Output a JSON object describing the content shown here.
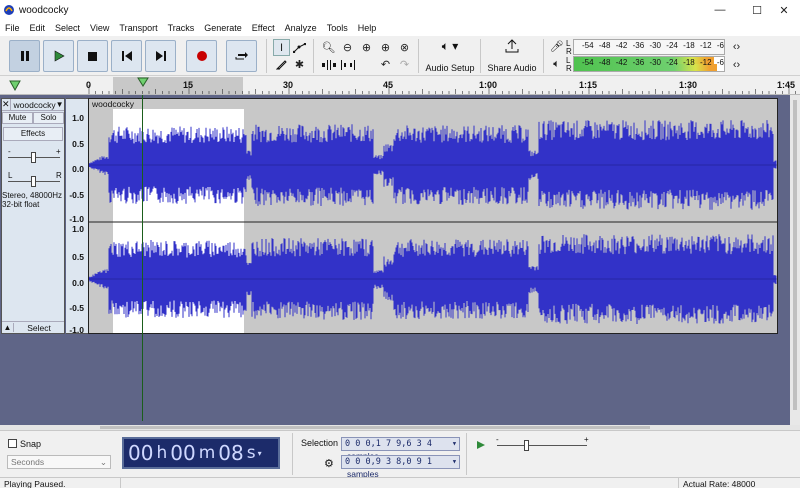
{
  "window": {
    "title": "woodcocky",
    "minimize_icon": "minimize-icon",
    "maximize_icon": "maximize-icon",
    "close_icon": "close-icon"
  },
  "menu": [
    "File",
    "Edit",
    "Select",
    "View",
    "Transport",
    "Tracks",
    "Generate",
    "Effect",
    "Analyze",
    "Tools",
    "Help"
  ],
  "toolbar": {
    "audio_setup_label": "Audio Setup",
    "share_audio_label": "Share Audio",
    "meter_ticks": [
      "-54",
      "-48",
      "-42",
      "-36",
      "-30",
      "-24",
      "-18",
      "-12",
      "-6"
    ],
    "recording_meter_level": 0,
    "playback_meter_left_level": 0.93,
    "playback_meter_right_level": 0.95
  },
  "timeline": {
    "ticks": [
      "0",
      "15",
      "30",
      "45",
      "1:00",
      "1:15",
      "1:30",
      "1:45"
    ]
  },
  "track": {
    "name": "woodcocky",
    "clip_name": "woodcocky",
    "mute_label": "Mute",
    "solo_label": "Solo",
    "effects_label": "Effects",
    "gain_minus": "-",
    "gain_plus": "+",
    "pan_left": "L",
    "pan_right": "R",
    "info_line1": "Stereo, 48000Hz",
    "info_line2": "32-bit float",
    "select_label": "Select",
    "ruler_labels": [
      "1.0",
      "0.5",
      "0.0",
      "-0.5",
      "-1.0"
    ]
  },
  "bottom": {
    "snap_label": "Snap",
    "snap_checked": false,
    "snap_unit": "Seconds",
    "time": {
      "h": "00",
      "h_unit": "h",
      "m": "00",
      "m_unit": "m",
      "s": "08",
      "s_unit": "s"
    },
    "selection_label": "Selection",
    "selection_start": "0 0 0,1 7 9,6 3 4",
    "selection_end": "0 0 0,9 3 8,0 9 1",
    "samples_label": "samples",
    "speed_minus": "-",
    "speed_plus": "+"
  },
  "status": {
    "message": "Playing Paused.",
    "actual_rate": "Actual Rate: 48000"
  },
  "colors": {
    "wave": "#3232c8",
    "wave_bg_selected": "#ffffff",
    "wave_bg": "#c8c8c8",
    "track_area": "#5f6587",
    "button_fill": "#dde6f0",
    "record_red": "#c80000",
    "play_green": "#2f8a3a"
  }
}
